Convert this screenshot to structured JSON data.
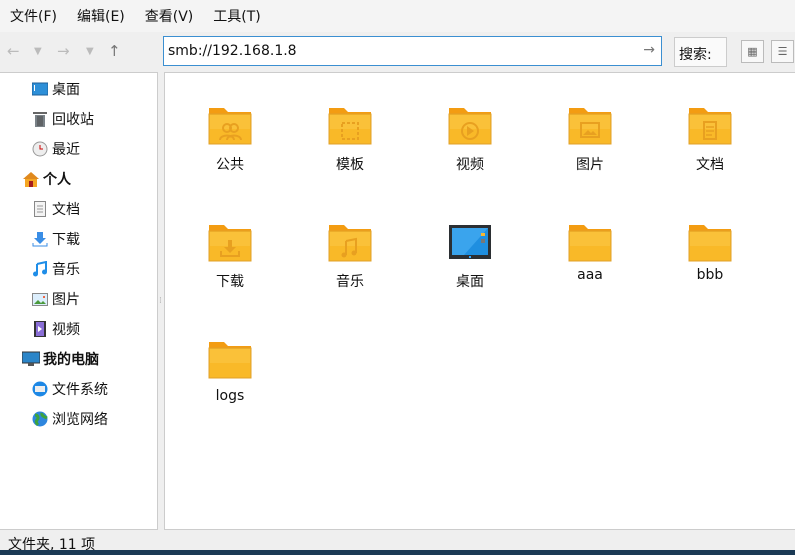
{
  "menu": [
    "文件(F)",
    "编辑(E)",
    "查看(V)",
    "工具(T)"
  ],
  "toolbar": {
    "address": "smb://192.168.1.8",
    "search_label": "搜索:"
  },
  "sidebar": [
    {
      "label": "桌面",
      "icon": "desktop-icon",
      "head": false
    },
    {
      "label": "回收站",
      "icon": "trash-icon",
      "head": false
    },
    {
      "label": "最近",
      "icon": "clock-icon",
      "head": false
    },
    {
      "label": "个人",
      "icon": "home-icon",
      "head": true
    },
    {
      "label": "文档",
      "icon": "document-icon",
      "head": false
    },
    {
      "label": "下载",
      "icon": "download-icon",
      "head": false
    },
    {
      "label": "音乐",
      "icon": "music-icon",
      "head": false
    },
    {
      "label": "图片",
      "icon": "picture-icon",
      "head": false
    },
    {
      "label": "视频",
      "icon": "video-icon",
      "head": false
    },
    {
      "label": "我的电脑",
      "icon": "computer-icon",
      "head": true
    },
    {
      "label": "文件系统",
      "icon": "drive-icon",
      "head": false
    },
    {
      "label": "浏览网络",
      "icon": "globe-icon",
      "head": false
    }
  ],
  "files": [
    {
      "name": "公共",
      "type": "public"
    },
    {
      "name": "模板",
      "type": "template"
    },
    {
      "name": "视频",
      "type": "video"
    },
    {
      "name": "图片",
      "type": "picture"
    },
    {
      "name": "文档",
      "type": "document"
    },
    {
      "name": "下载",
      "type": "download"
    },
    {
      "name": "音乐",
      "type": "music"
    },
    {
      "name": "桌面",
      "type": "desktop"
    },
    {
      "name": "aaa",
      "type": "plain"
    },
    {
      "name": "bbb",
      "type": "plain"
    },
    {
      "name": "logs",
      "type": "plain"
    }
  ],
  "status": "文件夹, 11 项",
  "colors": {
    "folder": "#f9b928",
    "folder_tab": "#f39c12",
    "accent": "#3b8fd1"
  }
}
